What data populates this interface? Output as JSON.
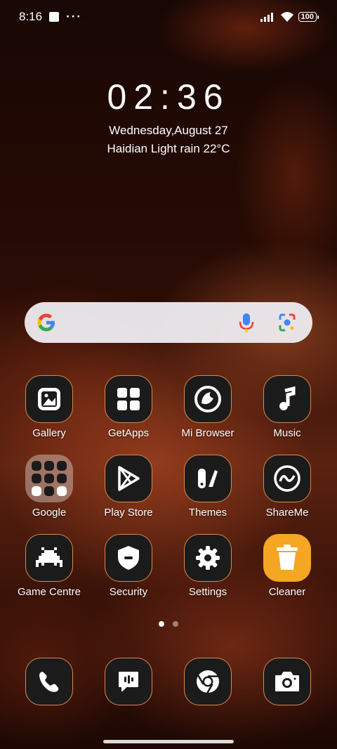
{
  "status_bar": {
    "time": "8:16",
    "more": "···",
    "battery": "100"
  },
  "clock": {
    "time": "02:36",
    "date": "Wednesday,August 27",
    "weather": "Haidian Light rain 22°C"
  },
  "search": {},
  "apps": [
    {
      "label": "Gallery",
      "icon": "gallery-icon"
    },
    {
      "label": "GetApps",
      "icon": "getapps-icon"
    },
    {
      "label": "Mi Browser",
      "icon": "mi-browser-icon"
    },
    {
      "label": "Music",
      "icon": "music-icon"
    },
    {
      "label": "Google",
      "icon": "google-folder-icon"
    },
    {
      "label": "Play Store",
      "icon": "play-store-icon"
    },
    {
      "label": "Themes",
      "icon": "themes-icon"
    },
    {
      "label": "ShareMe",
      "icon": "shareme-icon"
    },
    {
      "label": "Game Centre",
      "icon": "game-centre-icon"
    },
    {
      "label": "Security",
      "icon": "security-icon"
    },
    {
      "label": "Settings",
      "icon": "settings-icon"
    },
    {
      "label": "Cleaner",
      "icon": "cleaner-icon"
    }
  ],
  "dock": [
    {
      "icon": "phone-icon"
    },
    {
      "icon": "messages-icon"
    },
    {
      "icon": "chrome-icon"
    },
    {
      "icon": "camera-icon"
    }
  ],
  "colors": {
    "icon_border": "#d98a4a",
    "cleaner": "#f5a623"
  }
}
